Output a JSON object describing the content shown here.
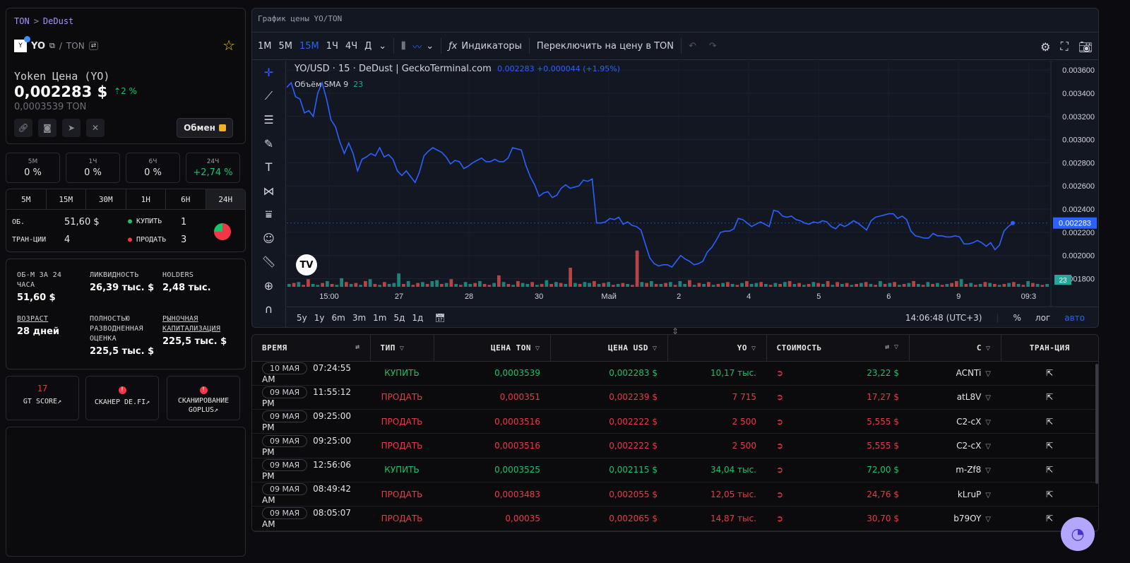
{
  "breadcrumb": {
    "network": "TON",
    "sep": ">",
    "dex": "DeDust"
  },
  "token": {
    "symbol": "YO",
    "quote": "TON",
    "name_line": "Yoken Цена (YO)",
    "price_usd": "0,002283 $",
    "change": "2 %",
    "price_ton": "0,0003539 TON",
    "swap_label": "Обмен"
  },
  "period_changes": [
    {
      "label": "5M",
      "value": "0 %"
    },
    {
      "label": "1Ч",
      "value": "0 %"
    },
    {
      "label": "6Ч",
      "value": "0 %"
    },
    {
      "label": "24Ч",
      "value": "+2,74 %"
    }
  ],
  "timeframes": [
    "5M",
    "15M",
    "30M",
    "1H",
    "6H",
    "24H"
  ],
  "active_timeframe": "24H",
  "volume_stats": {
    "vol_label": "ОБ.",
    "vol_value": "51,60 $",
    "tx_label": "ТРАН-ЦИИ",
    "tx_value": "4",
    "buy_label": "КУПИТЬ",
    "buy_value": "1",
    "sell_label": "ПРОДАТЬ",
    "sell_value": "3"
  },
  "info": {
    "vol24_label": "ОБ-М ЗА 24 ЧАСА",
    "vol24_value": "51,60 $",
    "liq_label": "ЛИКВИДНОСТЬ",
    "liq_value": "26,39 тыс. $",
    "holders_label": "HOLDERS",
    "holders_value": "2,48 тыс.",
    "age_label": "ВОЗРАСТ",
    "age_value": "28 дней",
    "fdv_label": "ПОЛНОСТЬЮ РАЗВОДНЕННАЯ ОЦЕНКА",
    "fdv_value": "225,5 тыс. $",
    "mcap_label": "РЫНОЧНАЯ КАПИТАЛИЗАЦИЯ",
    "mcap_value": "225,5 тыс. $"
  },
  "scanners": [
    {
      "top": "17",
      "label": "GT SCORE"
    },
    {
      "top": "!",
      "label": "СКАНЕР DE.FI"
    },
    {
      "top": "!",
      "label": "СКАНИРОВАНИЕ GOPLUS"
    }
  ],
  "chart_panel": {
    "title": "График цены YO/TON",
    "intervals": [
      "1M",
      "5M",
      "15M",
      "1Ч",
      "4Ч",
      "Д"
    ],
    "active_interval": "15M",
    "indicators_label": "Индикаторы",
    "switch_label": "Переключить на цену в TON",
    "legend_main": "YO/USD · 15 · DeDust | GeckoTerminal.com",
    "legend_value": "0.002283 +0.000044 (+1.95%)",
    "legend_vol": "Объём SMA 9",
    "legend_vol_value": "23",
    "ranges": [
      "5y",
      "1y",
      "6m",
      "3m",
      "1m",
      "5д",
      "1д"
    ],
    "clock": "14:06:48 (UTC+3)",
    "pct_label": "%",
    "log_label": "лог",
    "auto_label": "авто",
    "last_price_tag": "0.002283",
    "last_vol_tag": "23"
  },
  "chart_data": {
    "type": "line",
    "title": "YO/USD · 15 · DeDust",
    "x_ticks": [
      "15:00",
      "27",
      "28",
      "30",
      "Май",
      "2",
      "4",
      "5",
      "6",
      "9",
      "09:3"
    ],
    "y_ticks": [
      "0.003600",
      "0.003400",
      "0.003200",
      "0.003000",
      "0.002800",
      "0.002600",
      "0.002400",
      "0.002200",
      "0.002000",
      "0.001800"
    ],
    "ylim": [
      0.00173,
      0.00368
    ],
    "series": [
      {
        "name": "YO/USD",
        "color": "#2962ff",
        "values": [
          0.00345,
          0.00349,
          0.00337,
          0.00335,
          0.00323,
          0.00325,
          0.0032,
          0.0034,
          0.00349,
          0.00335,
          0.00317,
          0.00311,
          0.00298,
          0.00288,
          0.00297,
          0.00288,
          0.00273,
          0.00283,
          0.00285,
          0.00288,
          0.00286,
          0.00293,
          0.00285,
          0.00287,
          0.00283,
          0.00273,
          0.00269,
          0.00273,
          0.00268,
          0.00263,
          0.00272,
          0.00286,
          0.0029,
          0.00293,
          0.00291,
          0.00289,
          0.00285,
          0.00279,
          0.00282,
          0.00281,
          0.00275,
          0.00277,
          0.0028,
          0.00282,
          0.00284,
          0.00281,
          0.00281,
          0.00283,
          0.00281,
          0.00281,
          0.00284,
          0.00293,
          0.00292,
          0.00291,
          0.00278,
          0.00268,
          0.00261,
          0.00251,
          0.00254,
          0.00255,
          0.0025,
          0.00252,
          0.00258,
          0.00261,
          0.00258,
          0.00259,
          0.0026,
          0.00265,
          0.00264,
          0.00266,
          0.00228,
          0.00228,
          0.00229,
          0.00232,
          0.00231,
          0.00233,
          0.00227,
          0.00229,
          0.00226,
          0.00225,
          0.00222,
          0.0021,
          0.00198,
          0.00193,
          0.00191,
          0.00192,
          0.00192,
          0.0019,
          0.00195,
          0.002,
          0.00197,
          0.00195,
          0.00192,
          0.00193,
          0.00195,
          0.00203,
          0.00207,
          0.00213,
          0.0022,
          0.00221,
          0.00221,
          0.00223,
          0.00232,
          0.00231,
          0.00228,
          0.00225,
          0.00227,
          0.00229,
          0.00227,
          0.00225,
          0.00239,
          0.00238,
          0.00234,
          0.00233,
          0.00234,
          0.00231,
          0.0023,
          0.00228,
          0.00227,
          0.00229,
          0.00228,
          0.0023,
          0.00229,
          0.00225,
          0.00223,
          0.00227,
          0.00225,
          0.00227,
          0.0023,
          0.00228,
          0.00225,
          0.00222,
          0.0023,
          0.00233,
          0.00234,
          0.00235,
          0.00236,
          0.00236,
          0.00232,
          0.00234,
          0.00231,
          0.00221,
          0.00217,
          0.00216,
          0.00215,
          0.00215,
          0.00219,
          0.00217,
          0.00217,
          0.00216,
          0.00216,
          0.00217,
          0.00216,
          0.0021,
          0.0021,
          0.00211,
          0.00213,
          0.00211,
          0.00208,
          0.00211,
          0.00205,
          0.00209,
          0.00221,
          0.00225,
          0.00228
        ]
      }
    ],
    "volume": {
      "colors": {
        "up": "#26a69a",
        "down": "#ef5350"
      },
      "values": [
        3,
        4,
        5,
        2,
        8,
        3,
        2,
        4,
        6,
        3,
        2,
        9,
        5,
        3,
        4,
        2,
        6,
        8,
        3,
        2,
        5,
        3,
        4,
        14,
        3,
        6,
        2,
        4,
        5,
        3,
        6,
        7,
        3,
        4,
        8,
        3,
        2,
        5,
        3,
        4,
        6,
        3,
        2,
        4,
        12,
        5,
        3,
        2,
        6,
        4,
        3,
        5,
        2,
        3,
        7,
        3,
        5,
        4,
        3,
        20,
        4,
        3,
        5,
        4,
        6,
        3,
        4,
        5,
        2,
        3,
        4,
        3,
        2,
        38,
        5,
        4,
        6,
        3,
        3,
        4,
        5,
        2,
        6,
        3,
        7,
        2,
        4,
        3,
        5,
        2,
        3,
        4,
        5,
        3,
        2,
        4,
        6,
        3,
        4,
        5,
        3,
        2,
        4,
        3,
        5,
        6,
        3,
        4,
        2,
        3,
        5,
        4,
        3,
        6,
        2,
        5,
        3,
        4,
        2,
        3,
        4,
        5,
        3,
        2,
        6,
        3,
        4,
        5,
        2,
        3,
        4,
        6,
        3,
        2,
        5,
        3,
        4,
        2,
        3,
        4,
        6,
        8,
        3,
        4,
        2,
        3,
        5,
        4,
        3,
        2,
        3,
        4,
        5,
        3,
        2,
        6,
        4,
        3,
        2,
        3
      ],
      "up": [
        1,
        0,
        1,
        0,
        0,
        1,
        1,
        0,
        1,
        0,
        1,
        1,
        0,
        1,
        0,
        1,
        0,
        1,
        0,
        1,
        0,
        1,
        1,
        1,
        0,
        1,
        0,
        0,
        1,
        0,
        1,
        1,
        0,
        1,
        0,
        1,
        0,
        1,
        1,
        0,
        1,
        0,
        0,
        1,
        0,
        1,
        0,
        1,
        0,
        1,
        1,
        0,
        1,
        0,
        1,
        0,
        1,
        0,
        1,
        0,
        1,
        0,
        1,
        1,
        0,
        1,
        0,
        1,
        0,
        1,
        0,
        1,
        0,
        0,
        1,
        0,
        1,
        0,
        1,
        0,
        1,
        0,
        1,
        1,
        0,
        1,
        0,
        1,
        0,
        1,
        0,
        1,
        0,
        1,
        0,
        1,
        0,
        1,
        1,
        0,
        1,
        0,
        1,
        0,
        1,
        0,
        1,
        0,
        1,
        0,
        1,
        0,
        1,
        0,
        1,
        0,
        1,
        0,
        1,
        0,
        1,
        0,
        1,
        0,
        1,
        0,
        1,
        0,
        1,
        0,
        1,
        0,
        1,
        0,
        1,
        0,
        1,
        0,
        1,
        0,
        0,
        1,
        0,
        1,
        0,
        1,
        0,
        1,
        0,
        1,
        0,
        1,
        0,
        1,
        0,
        1,
        0,
        1,
        0,
        1
      ]
    }
  },
  "trades_table": {
    "columns": [
      "ВРЕМЯ",
      "ТИП",
      "ЦЕНА TON",
      "ЦЕНА USD",
      "YO",
      "СТОИМОСТЬ",
      "С",
      "ТРАН-ЦИЯ"
    ],
    "rows": [
      {
        "date": "10 МАЯ",
        "time": "07:24:55 AM",
        "type": "КУПИТЬ",
        "side": "buy",
        "price_ton": "0,0003539",
        "price_usd": "0,002283 $",
        "amount": "10,17 тыс.",
        "value": "23,22 $",
        "from": "ACNTi"
      },
      {
        "date": "09 МАЯ",
        "time": "11:55:12 PM",
        "type": "ПРОДАТЬ",
        "side": "sell",
        "price_ton": "0,000351",
        "price_usd": "0,002239 $",
        "amount": "7 715",
        "value": "17,27 $",
        "from": "atL8V"
      },
      {
        "date": "09 МАЯ",
        "time": "09:25:00 PM",
        "type": "ПРОДАТЬ",
        "side": "sell",
        "price_ton": "0,0003516",
        "price_usd": "0,002222 $",
        "amount": "2 500",
        "value": "5,555 $",
        "from": "C2-cX"
      },
      {
        "date": "09 МАЯ",
        "time": "09:25:00 PM",
        "type": "ПРОДАТЬ",
        "side": "sell",
        "price_ton": "0,0003516",
        "price_usd": "0,002222 $",
        "amount": "2 500",
        "value": "5,555 $",
        "from": "C2-cX"
      },
      {
        "date": "09 МАЯ",
        "time": "12:56:06 PM",
        "type": "КУПИТЬ",
        "side": "buy",
        "price_ton": "0,0003525",
        "price_usd": "0,002115 $",
        "amount": "34,04 тыс.",
        "value": "72,00 $",
        "from": "m-Zf8"
      },
      {
        "date": "09 МАЯ",
        "time": "08:49:42 AM",
        "type": "ПРОДАТЬ",
        "side": "sell",
        "price_ton": "0,0003483",
        "price_usd": "0,002055 $",
        "amount": "12,05 тыс.",
        "value": "24,76 $",
        "from": "kLruP"
      },
      {
        "date": "09 МАЯ",
        "time": "08:05:07 AM",
        "type": "ПРОДАТЬ",
        "side": "sell",
        "price_ton": "0,00035",
        "price_usd": "0,002065 $",
        "amount": "14,87 тыс.",
        "value": "30,70 $",
        "from": "b79OY"
      }
    ]
  },
  "colors": {
    "buy": "#16c46b",
    "sell": "#f23645",
    "accent": "#a493ff",
    "chart_line": "#2962ff"
  }
}
